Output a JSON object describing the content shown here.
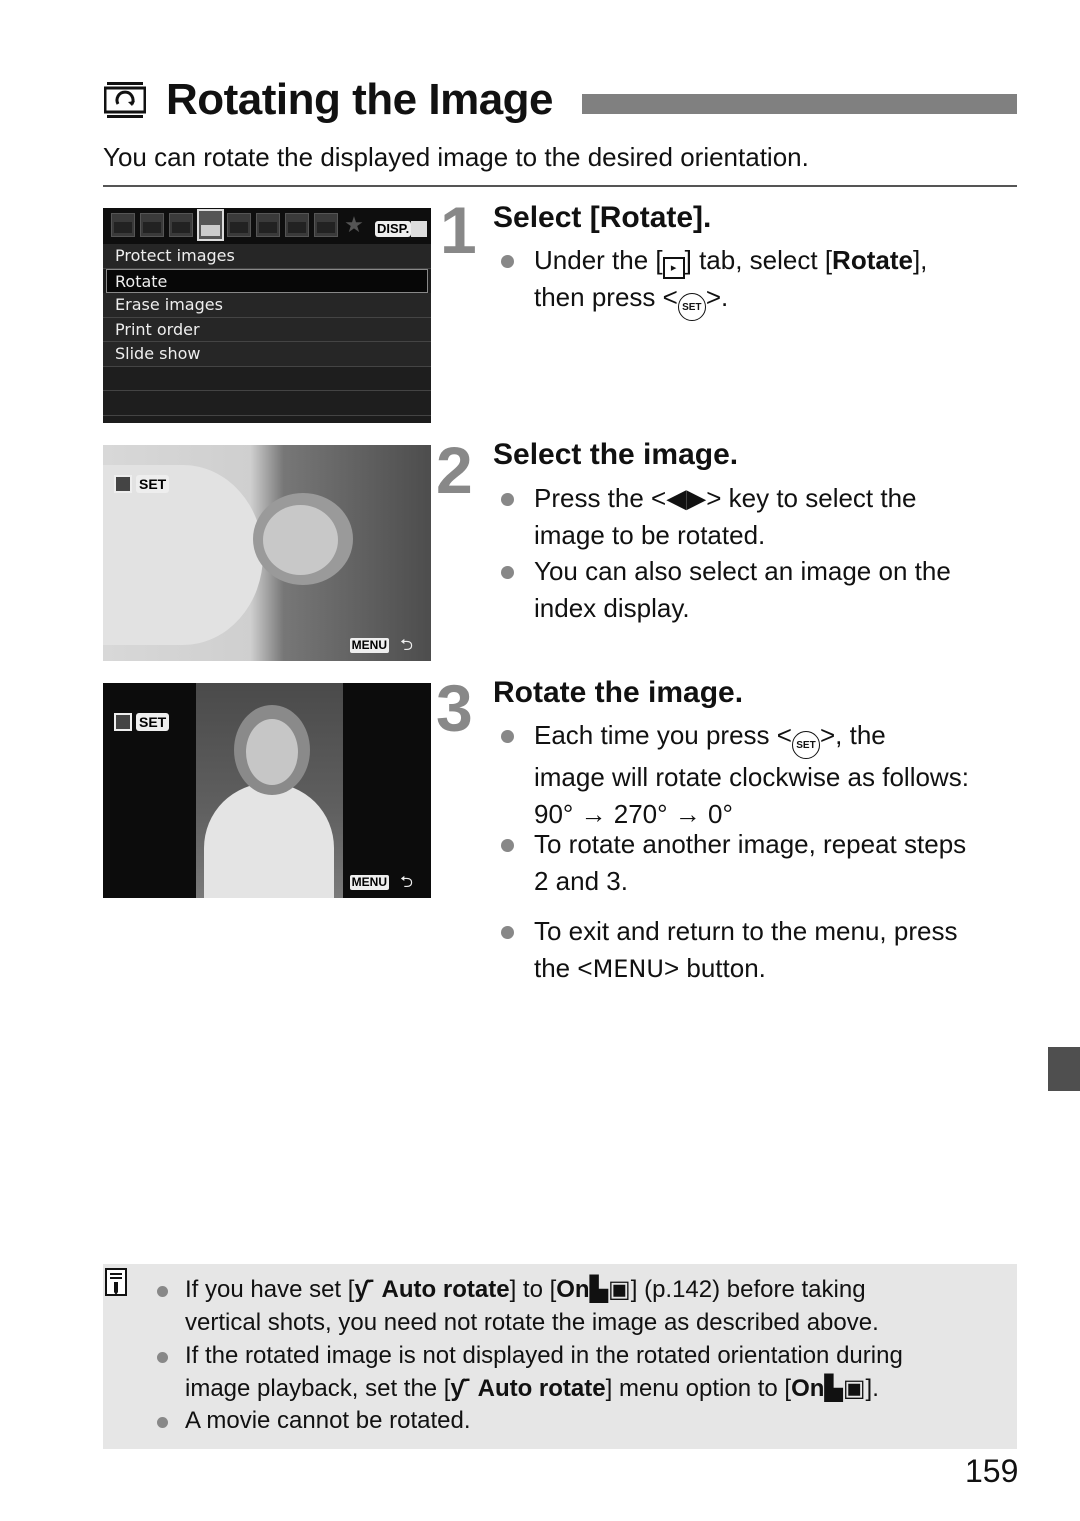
{
  "header": {
    "icon": "rotate-image-icon",
    "title": "Rotating the Image",
    "intro": "You can rotate the displayed image to the desired orientation."
  },
  "menu_screen": {
    "tabs": [
      {
        "icon": "shooting-tab-1-icon",
        "active": false
      },
      {
        "icon": "shooting-tab-2-icon",
        "active": false
      },
      {
        "icon": "shooting-tab-3-icon",
        "active": false
      },
      {
        "icon": "playback-tab-1-icon",
        "active": true
      },
      {
        "icon": "playback-tab-2-icon",
        "active": false
      },
      {
        "icon": "setup-tab-1-icon",
        "active": false
      },
      {
        "icon": "setup-tab-2-icon",
        "active": false
      },
      {
        "icon": "setup-tab-3-icon",
        "active": false
      },
      {
        "icon": "my-menu-star-icon",
        "active": false
      }
    ],
    "disp_label": "DISP.",
    "items": [
      "Protect images",
      "Rotate",
      "Erase images",
      "Print order",
      "Slide show",
      "",
      ""
    ],
    "selected_index": 1
  },
  "photo_screens": {
    "set_label": "SET",
    "menu_label": "MENU",
    "back_glyph": "⮌"
  },
  "steps": [
    {
      "number": "1",
      "heading": "Select [Rotate].",
      "bullets": [
        {
          "pre": "Under the [",
          "icon": "▸",
          "mid": "] tab, select [",
          "bold": "Rotate",
          "post1": "],",
          "line2_pre": "then press <",
          "set": "SET",
          "line2_post": ">."
        }
      ]
    },
    {
      "number": "2",
      "heading": "Select the image.",
      "bullets": [
        {
          "pre": "Press the <",
          "keys": "◀▶",
          "post": "> key to select the",
          "line2": "image to be rotated."
        },
        {
          "line1": "You can also select an image on the",
          "line2": "index display."
        }
      ]
    },
    {
      "number": "3",
      "heading": "Rotate the image.",
      "bullets": [
        {
          "pre": "Each time you press <",
          "set": "SET",
          "post": ">, the",
          "line2": "image will rotate clockwise as follows:",
          "line3": "90° → 270° → 0°"
        },
        {
          "line1": "To rotate another image, repeat steps",
          "line2": "2 and 3."
        },
        {
          "line1": "To exit and return to the menu, press",
          "line2_pre": "the <",
          "menu": "MENU",
          "line2_post": "> button."
        }
      ]
    }
  ],
  "note": {
    "icon": "memo-pencil-icon",
    "bullets": [
      {
        "p1": "If you have set [",
        "wrench": "ƴ˙",
        "b1": " Auto rotate",
        "p2": "] to [",
        "b2": "On",
        "cam": "▙",
        "mon": "▣",
        "p3": "] (p.142) before taking",
        "line2": "vertical shots, you need not rotate the image as described above."
      },
      {
        "line1": "If the rotated image is not displayed in the rotated orientation during",
        "p1": "image playback, set the [",
        "wrench": "ƴ˙",
        "b1": " Auto rotate",
        "p2": "] menu option to [",
        "b2": "On",
        "cam": "▙",
        "mon": "▣",
        "p3": "]."
      },
      {
        "line1": "A movie cannot be rotated."
      }
    ]
  },
  "page_number": "159"
}
